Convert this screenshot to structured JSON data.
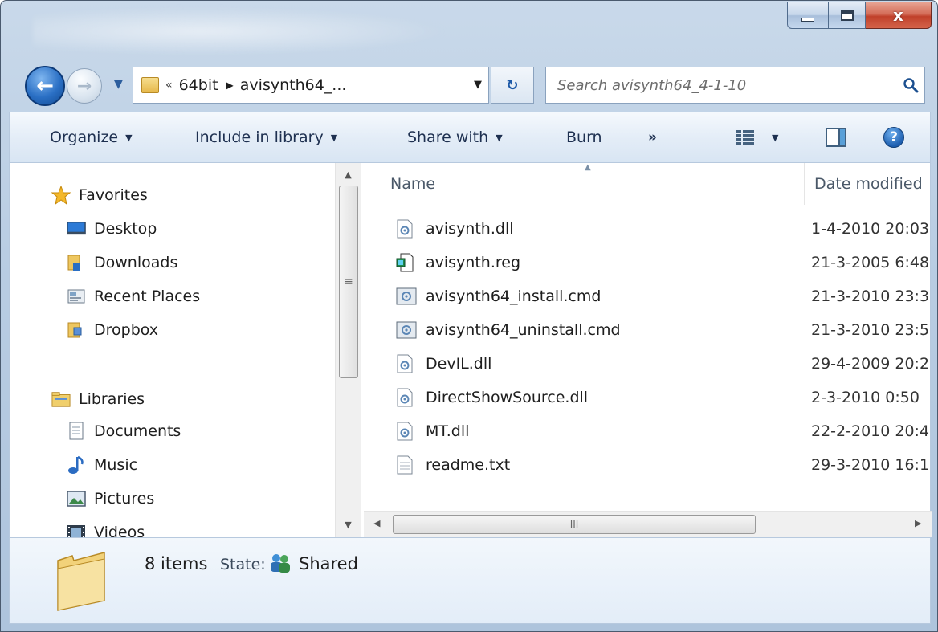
{
  "window": {
    "controls": {
      "minimize": "minimize",
      "maximize": "maximize",
      "close": "x"
    }
  },
  "nav": {
    "address": {
      "overflow": "«",
      "crumbs": [
        "64bit",
        "avisynth64_..."
      ]
    },
    "search": {
      "placeholder": "Search avisynth64_4-1-10"
    }
  },
  "toolbar": {
    "organize": "Organize",
    "include": "Include in library",
    "share": "Share with",
    "burn": "Burn",
    "more": "»"
  },
  "sidebar": {
    "favorites": {
      "label": "Favorites",
      "items": [
        "Desktop",
        "Downloads",
        "Recent Places",
        "Dropbox"
      ]
    },
    "libraries": {
      "label": "Libraries",
      "items": [
        "Documents",
        "Music",
        "Pictures",
        "Videos"
      ]
    }
  },
  "files": {
    "columns": {
      "name": "Name",
      "date": "Date modified"
    },
    "rows": [
      {
        "name": "avisynth.dll",
        "date": "1-4-2010 20:03",
        "icon": "dll-file-icon"
      },
      {
        "name": "avisynth.reg",
        "date": "21-3-2005 6:48",
        "icon": "registry-file-icon"
      },
      {
        "name": "avisynth64_install.cmd",
        "date": "21-3-2010 23:3",
        "icon": "cmd-file-icon"
      },
      {
        "name": "avisynth64_uninstall.cmd",
        "date": "21-3-2010 23:5",
        "icon": "cmd-file-icon"
      },
      {
        "name": "DevIL.dll",
        "date": "29-4-2009 20:2",
        "icon": "dll-file-icon"
      },
      {
        "name": "DirectShowSource.dll",
        "date": "2-3-2010 0:50",
        "icon": "dll-file-icon"
      },
      {
        "name": "MT.dll",
        "date": "22-2-2010 20:4",
        "icon": "dll-file-icon"
      },
      {
        "name": "readme.txt",
        "date": "29-3-2010 16:1",
        "icon": "text-file-icon"
      }
    ]
  },
  "scroll": {
    "h_thumb_glyph": "III",
    "v_thumb_glyph": "≡"
  },
  "details": {
    "count": "8 items",
    "state_label": "State:",
    "state_value": "Shared"
  },
  "colors": {
    "chrome": "#c9d9ea",
    "close_button": "#c0402a",
    "nav_back": "#2a6fc4"
  }
}
